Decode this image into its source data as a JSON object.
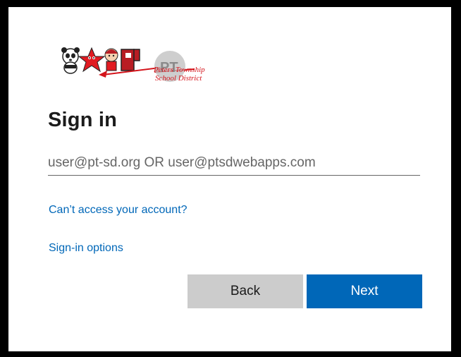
{
  "logo": {
    "line1": "Peters Township",
    "line2": "School District",
    "icon": "district-mascot-logo"
  },
  "title": "Sign in",
  "email": {
    "value": "",
    "placeholder": "user@pt-sd.org OR user@ptsdwebapps.com"
  },
  "links": {
    "cant_access": "Can’t access your account?",
    "signin_options": "Sign-in options"
  },
  "buttons": {
    "back": "Back",
    "next": "Next"
  },
  "colors": {
    "accent": "#0067b8",
    "back_button": "#cccccc",
    "logo_red": "#d4141b",
    "frame": "#000000"
  }
}
